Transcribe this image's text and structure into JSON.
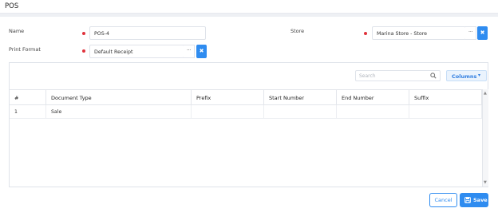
{
  "header": {
    "title": "POS"
  },
  "form": {
    "name": {
      "label": "Name",
      "value": "POS-4"
    },
    "store": {
      "label": "Store",
      "value": "Marina Store - Store",
      "browse": "···",
      "clear": "✖"
    },
    "print_format": {
      "label": "Print Format",
      "value": "Default Receipt",
      "browse": "···",
      "clear": "✖"
    },
    "required_color": "#e0323c"
  },
  "grid": {
    "search_placeholder": "Search",
    "columns_button": "Columns",
    "headers": [
      "#",
      "Document Type",
      "Prefix",
      "Start Number",
      "End Number",
      "Suffix"
    ],
    "rows": [
      {
        "num": "1",
        "document_type": "Sale",
        "prefix": "",
        "start_number": "",
        "end_number": "",
        "suffix": ""
      }
    ]
  },
  "footer": {
    "cancel_label": "Cancel",
    "save_label": "Save"
  },
  "colors": {
    "accent": "#2f8cf0",
    "border": "#dfe3ea"
  }
}
